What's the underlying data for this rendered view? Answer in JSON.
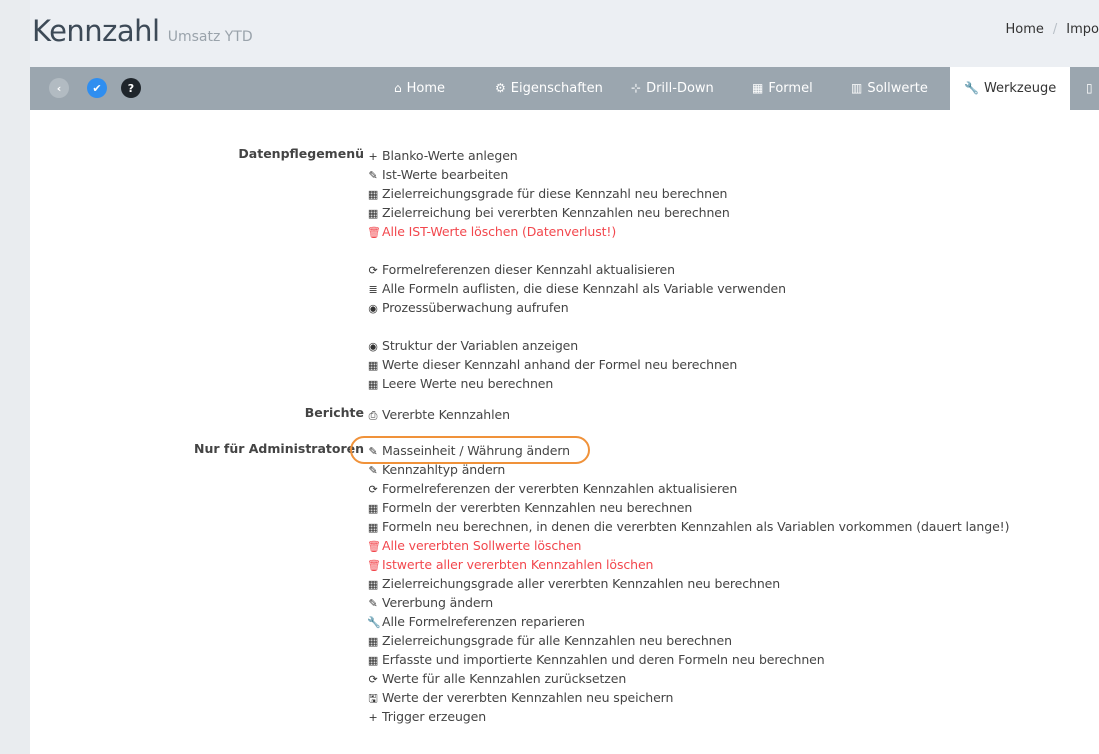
{
  "header": {
    "title": "Kennzahl",
    "subtitle": "Umsatz YTD"
  },
  "breadcrumb": [
    "Home",
    "Impo"
  ],
  "navbar": {
    "buttons": {
      "back": {
        "icon": "chevron-left-icon",
        "glyph": "‹"
      },
      "check": {
        "icon": "check-icon",
        "glyph": "✔"
      },
      "help": {
        "icon": "question-icon",
        "glyph": "?"
      }
    },
    "tabs": [
      {
        "label": "Home",
        "icon": "home-icon",
        "glyph": "⌂"
      },
      {
        "label": "Eigenschaften",
        "icon": "gear-icon",
        "glyph": "⚙"
      },
      {
        "label": "Drill-Down",
        "icon": "sitemap-icon",
        "glyph": "⊹"
      },
      {
        "label": "Formel",
        "icon": "calculator-icon",
        "glyph": "▦"
      },
      {
        "label": "Sollwerte",
        "icon": "bar-chart-icon",
        "glyph": "▥"
      },
      {
        "label": "Werkzeuge",
        "icon": "wrench-icon",
        "glyph": "🔧",
        "active": true
      },
      {
        "label": "",
        "icon": "file-icon",
        "glyph": "▯"
      }
    ]
  },
  "sections": {
    "datenpflege": {
      "label": "Datenpflegemenü",
      "items": [
        {
          "text": "Blanko-Werte anlegen",
          "glyph": "+",
          "icon": "plus-icon"
        },
        {
          "text": "Ist-Werte bearbeiten",
          "glyph": "✎",
          "icon": "pencil-icon"
        },
        {
          "text": "Zielerreichungsgrade für diese Kennzahl neu berechnen",
          "glyph": "▦",
          "icon": "calculator-icon"
        },
        {
          "text": "Zielerreichung bei vererbten Kennzahlen neu berechnen",
          "glyph": "▦",
          "icon": "calculator-icon"
        },
        {
          "text": "Alle IST-Werte löschen (Datenverlust!)",
          "glyph": "🗑",
          "icon": "trash-icon",
          "danger": true
        },
        {
          "gap": true
        },
        {
          "text": "Formelreferenzen dieser Kennzahl aktualisieren",
          "glyph": "⟳",
          "icon": "refresh-icon"
        },
        {
          "text": "Alle Formeln auflisten, die diese Kennzahl als Variable verwenden",
          "glyph": "≣",
          "icon": "list-icon"
        },
        {
          "text": "Prozessüberwachung aufrufen",
          "glyph": "◉",
          "icon": "eye-icon"
        },
        {
          "gap": true
        },
        {
          "text": "Struktur der Variablen anzeigen",
          "glyph": "◉",
          "icon": "eye-icon"
        },
        {
          "text": "Werte dieser Kennzahl anhand der Formel neu berechnen",
          "glyph": "▦",
          "icon": "calculator-icon"
        },
        {
          "text": "Leere Werte neu berechnen",
          "glyph": "▦",
          "icon": "calculator-icon"
        }
      ]
    },
    "berichte": {
      "label": "Berichte",
      "items": [
        {
          "text": "Vererbte Kennzahlen",
          "glyph": "⎙",
          "icon": "print-icon"
        }
      ]
    },
    "admin": {
      "label": "Nur für Administratoren",
      "items": [
        {
          "text": "Masseinheit / Währung ändern",
          "glyph": "✎",
          "icon": "pencil-icon"
        },
        {
          "text": "Kennzahltyp ändern",
          "glyph": "✎",
          "icon": "pencil-icon"
        },
        {
          "text": "Formelreferenzen der vererbten Kennzahlen aktualisieren",
          "glyph": "⟳",
          "icon": "refresh-icon"
        },
        {
          "text": "Formeln der vererbten Kennzahlen neu berechnen",
          "glyph": "▦",
          "icon": "calculator-icon"
        },
        {
          "text": "Formeln neu berechnen, in denen die vererbten Kennzahlen als Variablen vorkommen (dauert lange!)",
          "glyph": "▦",
          "icon": "calculator-icon"
        },
        {
          "text": "Alle vererbten Sollwerte löschen",
          "glyph": "🗑",
          "icon": "trash-icon",
          "danger": true
        },
        {
          "text": "Istwerte aller vererbten Kennzahlen löschen",
          "glyph": "🗑",
          "icon": "trash-icon",
          "danger": true
        },
        {
          "text": "Zielerreichungsgrade aller vererbten Kennzahlen neu berechnen",
          "glyph": "▦",
          "icon": "calculator-icon"
        },
        {
          "text": "Vererbung ändern",
          "glyph": "✎",
          "icon": "pencil-icon"
        },
        {
          "text": "Alle Formelreferenzen reparieren",
          "glyph": "🔧",
          "icon": "wrench-icon"
        },
        {
          "text": "Zielerreichungsgrade für alle Kennzahlen neu berechnen",
          "glyph": "▦",
          "icon": "calculator-icon"
        },
        {
          "text": "Erfasste und importierte Kennzahlen und deren Formeln neu berechnen",
          "glyph": "▦",
          "icon": "calculator-icon"
        },
        {
          "text": "Werte für alle Kennzahlen zurücksetzen",
          "glyph": "⟳",
          "icon": "refresh-icon"
        },
        {
          "text": "Werte der vererbten Kennzahlen neu speichern",
          "glyph": "🖫",
          "icon": "save-icon"
        },
        {
          "text": "Trigger erzeugen",
          "glyph": "+",
          "icon": "plus-icon"
        }
      ]
    }
  },
  "colors": {
    "danger": "#f2474d",
    "accent": "#2f8ef0",
    "highlight": "#f0923a",
    "navbar": "#9ba6af"
  }
}
